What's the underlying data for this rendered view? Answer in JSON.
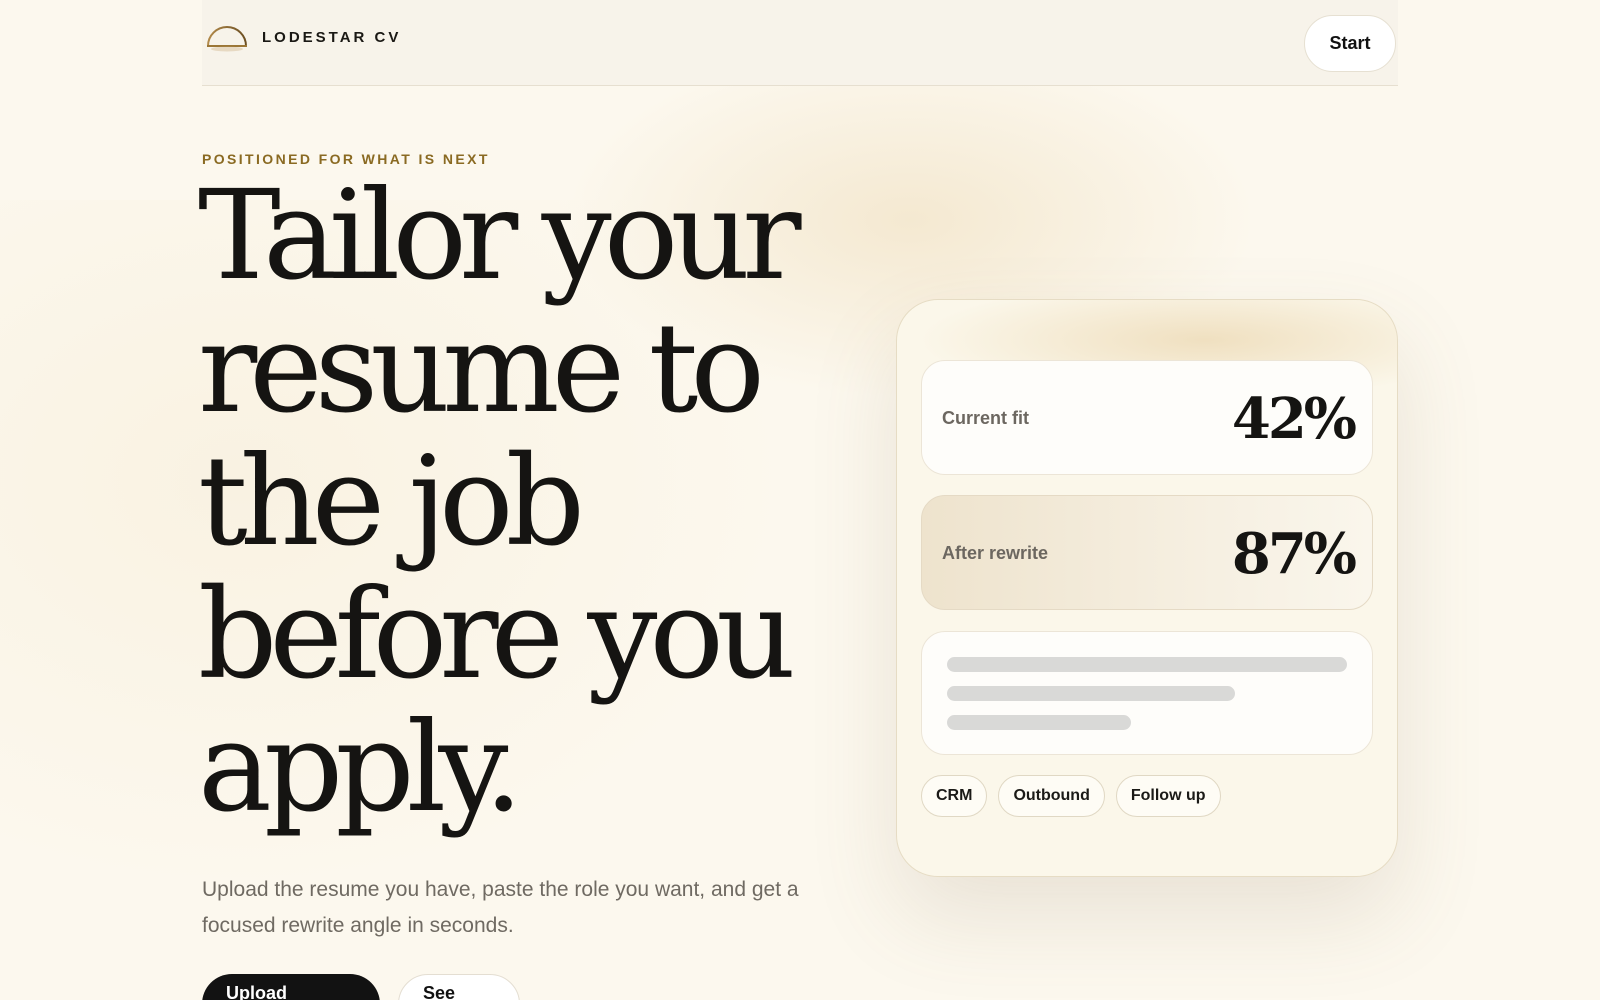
{
  "header": {
    "brand": "LODESTAR CV",
    "start_label": "Start"
  },
  "hero": {
    "eyebrow": "POSITIONED FOR WHAT IS NEXT",
    "headline_lines": [
      "Tailor your",
      "resume to",
      "the job",
      "before you",
      "apply."
    ],
    "subtext": "Upload the resume you have, paste the role you want, and get a focused rewrite angle in seconds.",
    "primary_cta": "Upload resume",
    "secondary_cta": "See flow"
  },
  "card": {
    "current": {
      "label": "Current fit",
      "value": "42%"
    },
    "after": {
      "label": "After rewrite",
      "value": "87%"
    },
    "tags": [
      "CRM",
      "Outbound",
      "Follow up"
    ]
  },
  "colors": {
    "background": "#fcf8ee",
    "accent_gold": "#8a6a22",
    "ink": "#151412",
    "primary_button": "#121212"
  },
  "icons": {
    "logo": "half-sun-horizon-icon"
  }
}
